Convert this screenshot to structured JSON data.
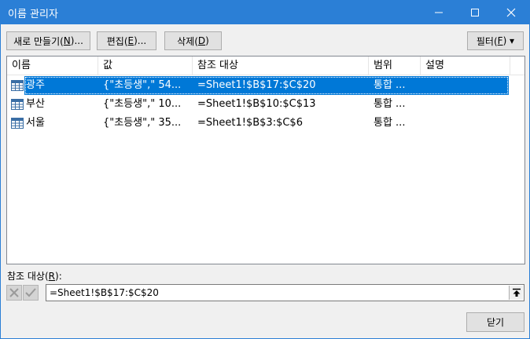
{
  "window": {
    "title": "이름 관리자"
  },
  "toolbar": {
    "new": {
      "text": "새로 만들기(",
      "key": "N",
      "suffix": ")..."
    },
    "edit": {
      "text": "편집(",
      "key": "E",
      "suffix": ")..."
    },
    "delete": {
      "text": "삭제(",
      "key": "D",
      "suffix": ")"
    },
    "filter": {
      "text": "필터(",
      "key": "F",
      "suffix": ") ▾"
    }
  },
  "table": {
    "columns": [
      "이름",
      "값",
      "참조 대상",
      "범위",
      "설명"
    ],
    "rows": [
      {
        "name": "광주",
        "value": "{\"초등생\",\" 54...",
        "ref": "=Sheet1!$B$17:$C$20",
        "scope": "통합 ...",
        "comment": "",
        "selected": true
      },
      {
        "name": "부산",
        "value": "{\"초등생\",\" 10...",
        "ref": "=Sheet1!$B$10:$C$13",
        "scope": "통합 ...",
        "comment": "",
        "selected": false
      },
      {
        "name": "서울",
        "value": "{\"초등생\",\" 35...",
        "ref": "=Sheet1!$B$3:$C$6",
        "scope": "통합 ...",
        "comment": "",
        "selected": false
      }
    ]
  },
  "refers": {
    "label_text": "참조 대상(",
    "label_key": "R",
    "label_suffix": "):",
    "value": "=Sheet1!$B$17:$C$20"
  },
  "footer": {
    "close_text": "닫기"
  },
  "colors": {
    "titlebar": "#2b7fd6",
    "selection": "#0078d7"
  }
}
